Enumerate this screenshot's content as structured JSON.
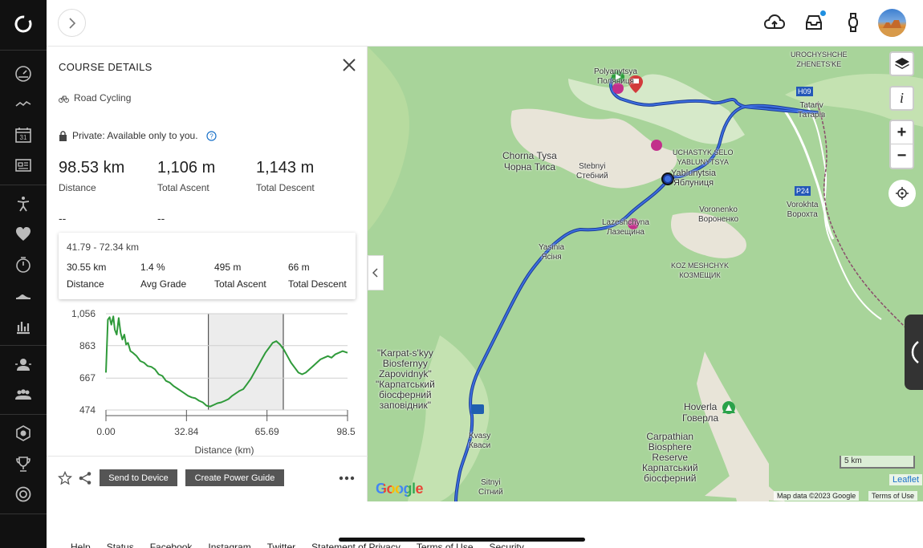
{
  "panel": {
    "title": "COURSE DETAILS",
    "activity_type": "Road Cycling",
    "privacy": "Private: Available only to you.",
    "stats": [
      {
        "value": "98.53 km",
        "label": "Distance"
      },
      {
        "value": "1,106 m",
        "label": "Total Ascent"
      },
      {
        "value": "1,143 m",
        "label": "Total Descent"
      }
    ],
    "placeholders": [
      "--",
      "--"
    ],
    "selection": {
      "range": "41.79 - 72.34 km",
      "stats": [
        {
          "value": "30.55 km",
          "label": "Distance"
        },
        {
          "value": "1.4 %",
          "label": "Avg Grade"
        },
        {
          "value": "495 m",
          "label": "Total Ascent"
        },
        {
          "value": "66 m",
          "label": "Total Descent"
        }
      ]
    },
    "footer": {
      "send_label": "Send to Device",
      "power_label": "Create Power Guide"
    }
  },
  "chart_data": {
    "type": "line",
    "xlabel": "Distance (km)",
    "ylabel": "",
    "x_ticks": [
      "0.00",
      "32.84",
      "65.69",
      "98.5"
    ],
    "y_ticks": [
      "1,056",
      "863",
      "667",
      "474"
    ],
    "xlim": [
      0,
      98.53
    ],
    "ylim": [
      474,
      1056
    ],
    "highlight_range": [
      41.79,
      72.34
    ],
    "x": [
      0,
      0.8,
      1.5,
      2.2,
      3,
      3.6,
      4.4,
      5.2,
      6,
      6.7,
      7.5,
      8.2,
      9,
      10,
      11,
      12.5,
      14,
      15.5,
      17,
      18.5,
      20,
      21.5,
      23,
      24.5,
      26,
      27.5,
      29,
      30.5,
      32,
      33.5,
      35,
      36.5,
      38,
      39.5,
      41,
      42.5,
      44,
      45.5,
      47,
      48.5,
      50,
      51.5,
      53,
      54.5,
      56,
      57.5,
      59,
      60.5,
      62,
      63.5,
      65,
      66.5,
      68,
      69.5,
      71,
      72.5,
      74,
      75.5,
      77,
      78.5,
      80,
      81.5,
      83,
      84.5,
      86,
      87.5,
      89,
      90.5,
      92,
      93.5,
      95,
      96.5,
      98.53
    ],
    "series": [
      {
        "values": [
          700,
          1020,
          1035,
          990,
          1040,
          960,
          930,
          1030,
          940,
          900,
          930,
          870,
          880,
          830,
          820,
          800,
          770,
          760,
          740,
          735,
          720,
          690,
          680,
          650,
          640,
          620,
          605,
          590,
          575,
          560,
          550,
          545,
          530,
          520,
          500,
          495,
          505,
          515,
          520,
          530,
          540,
          560,
          575,
          590,
          600,
          630,
          660,
          700,
          740,
          780,
          820,
          850,
          880,
          890,
          870,
          840,
          800,
          760,
          730,
          700,
          690,
          700,
          720,
          740,
          760,
          780,
          790,
          800,
          790,
          810,
          820,
          830,
          820
        ]
      }
    ]
  },
  "map": {
    "labels": {
      "polyanytsya": "Polyanytsya\nПоляниця",
      "urochyshche": "UROCHYSHCHE\nZHENETS'KE",
      "h09": "H09",
      "tatariv": "Tatariv\nТатарів",
      "chorna_tysa": "Chorna Tysa\nЧорна Тиса",
      "stebnyi": "Stebnyi\nСтебний",
      "uchastyk": "UCHASTYK SELO\nYABLUNYTSYA",
      "yablunytsia": "Yablunytsia\nЯблуниця",
      "p24": "P24",
      "vorokhta": "Vorokhta\nВорохта",
      "voronenko": "Voronenko\nВороненко",
      "lazeshchyna": "Lazeshchyna\nЛазещина",
      "yasinia": "Yasinia\nЯсіня",
      "koz_meshchyk": "KOZ MESHCHYK\nКОЗМЕЩИК",
      "karpatskyy": "\"Karpat-s'kyy\nBiosfernyy\nZapovidnyk\"\n\"Карпатський\nбіосферний\nзаповідник\"",
      "hoverla": "Hoverla\nГоверла",
      "kvasy": "Kvasy\nКваси",
      "carpathian": "Carpathian\nBiosphere\nReserve\nКарпатський\nбіосферний",
      "sitnyi": "Sitnyi\nСітний"
    },
    "scale_label": "5 km",
    "leaflet_label": "Leaflet",
    "map_data": "Map data ©2023 Google",
    "terms": "Terms of Use",
    "google": "Google"
  },
  "footer": {
    "links": [
      "Help",
      "Status",
      "Facebook",
      "Instagram",
      "Twitter",
      "Statement of Privacy",
      "Terms of Use",
      "Security"
    ]
  }
}
